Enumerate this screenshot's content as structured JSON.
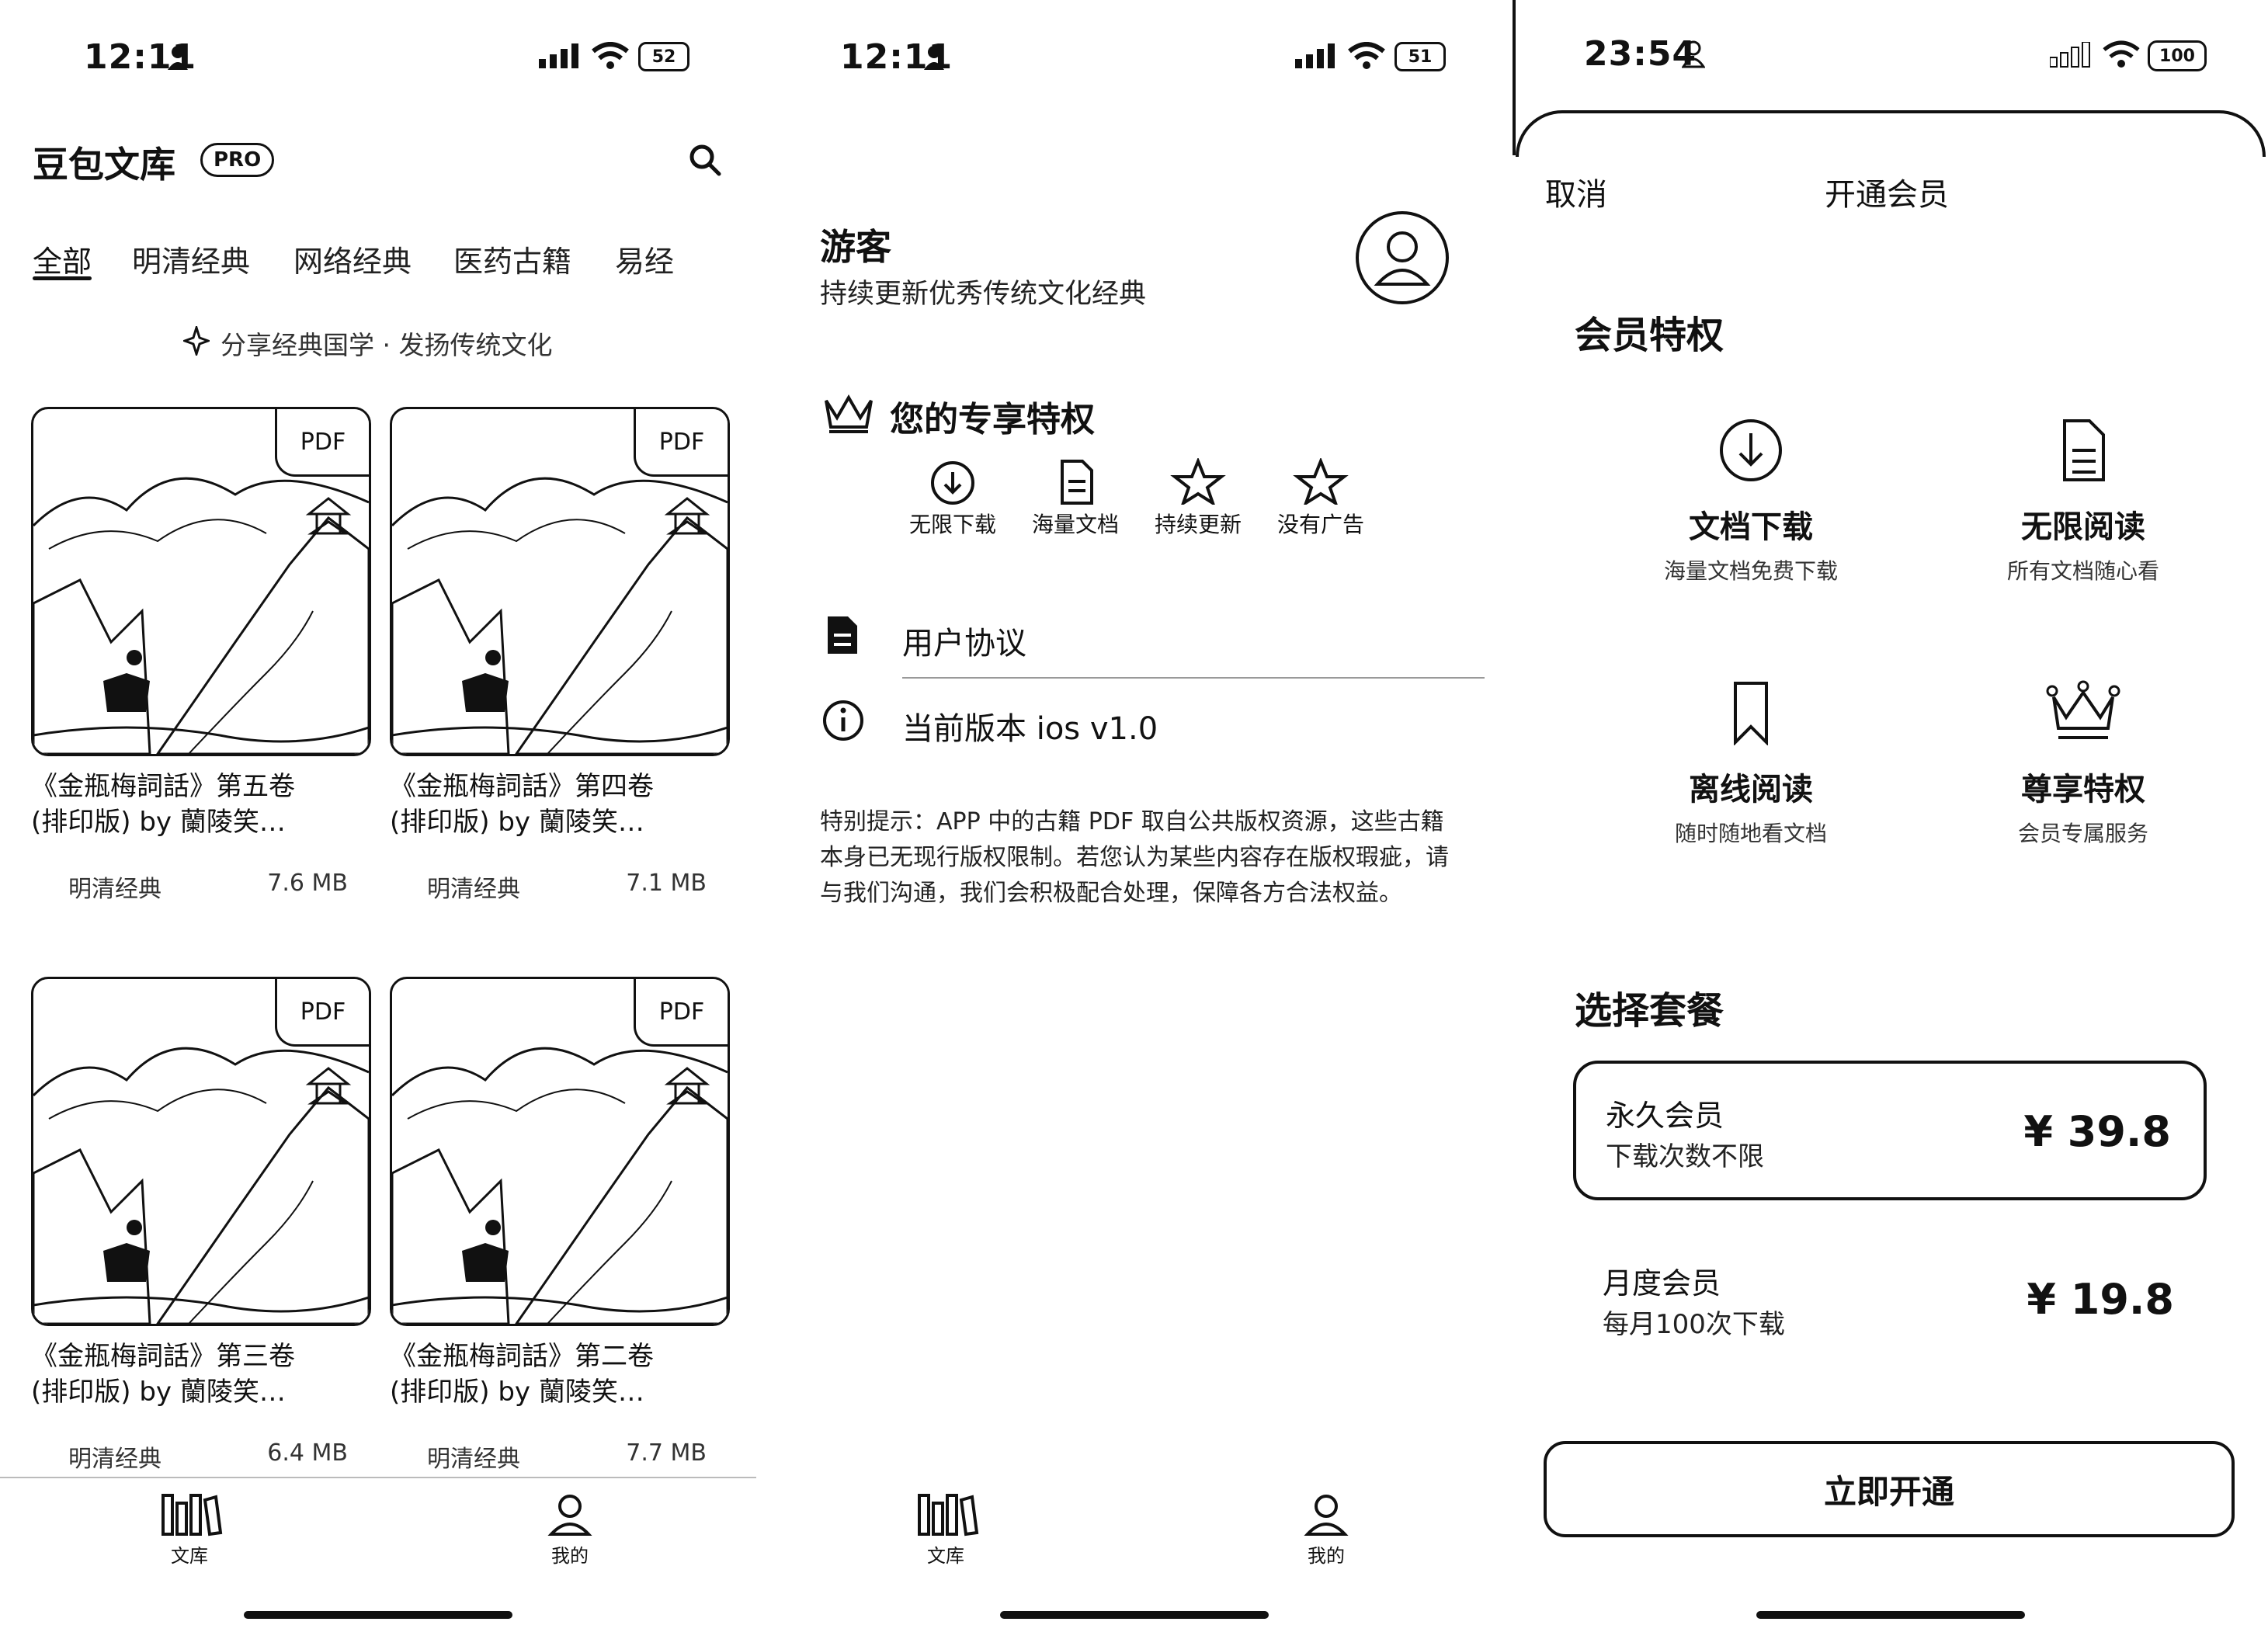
{
  "library_screen": {
    "status_time": "12:11",
    "battery": "52",
    "app_title": "豆包文库",
    "pro_badge": "PRO",
    "tabs": [
      "全部",
      "明清经典",
      "网络经典",
      "医药古籍",
      "易经"
    ],
    "slogan": "分享经典国学 · 发扬传统文化",
    "books": [
      {
        "title_line1": "《金瓶梅詞話》第五卷",
        "title_line2": "(排印版) by 蘭陵笑…",
        "category": "明清经典",
        "size": "7.6 MB",
        "badge": "PDF"
      },
      {
        "title_line1": "《金瓶梅詞話》第四卷",
        "title_line2": "(排印版) by 蘭陵笑…",
        "category": "明清经典",
        "size": "7.1 MB",
        "badge": "PDF"
      },
      {
        "title_line1": "《金瓶梅詞話》第三卷",
        "title_line2": "(排印版) by 蘭陵笑…",
        "category": "明清经典",
        "size": "6.4 MB",
        "badge": "PDF"
      },
      {
        "title_line1": "《金瓶梅詞話》第二卷",
        "title_line2": "(排印版) by 蘭陵笑…",
        "category": "明清经典",
        "size": "7.7 MB",
        "badge": "PDF"
      }
    ],
    "tabbar": {
      "library": "文库",
      "mine": "我的"
    }
  },
  "profile_screen": {
    "status_time": "12:11",
    "battery": "51",
    "user_name": "游客",
    "user_subtitle": "持续更新优秀传统文化经典",
    "perks_title": "您的专享特权",
    "perks": [
      "无限下载",
      "海量文档",
      "持续更新",
      "没有广告"
    ],
    "menu": {
      "agreement": "用户协议",
      "version": "当前版本 ios v1.0"
    },
    "notice": "特别提示：APP 中的古籍 PDF 取自公共版权资源，这些古籍本身已无现行版权限制。若您认为某些内容存在版权瑕疵，请与我们沟通，我们会积极配合处理，保障各方合法权益。",
    "tabbar": {
      "library": "文库",
      "mine": "我的"
    }
  },
  "membership_screen": {
    "status_time": "23:54",
    "battery": "100",
    "cancel": "取消",
    "header_title": "开通会员",
    "benefits_title": "会员特权",
    "features": [
      {
        "title": "文档下载",
        "subtitle": "海量文档免费下载",
        "icon": "download-icon"
      },
      {
        "title": "无限阅读",
        "subtitle": "所有文档随心看",
        "icon": "document-icon"
      },
      {
        "title": "离线阅读",
        "subtitle": "随时随地看文档",
        "icon": "bookmark-icon"
      },
      {
        "title": "尊享特权",
        "subtitle": "会员专属服务",
        "icon": "crown-icon"
      }
    ],
    "plans_title": "选择套餐",
    "plans": [
      {
        "name": "永久会员",
        "desc": "下载次数不限",
        "price": "¥ 39.8",
        "selected": true
      },
      {
        "name": "月度会员",
        "desc": "每月100次下载",
        "price": "¥ 19.8",
        "selected": false
      }
    ],
    "cta": "立即开通"
  }
}
